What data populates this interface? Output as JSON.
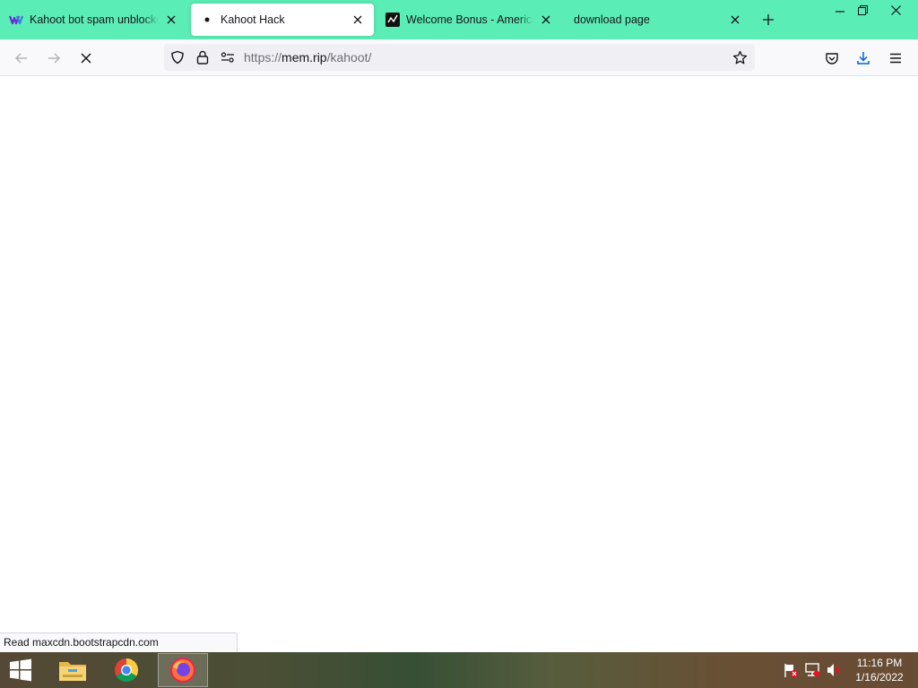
{
  "browser": {
    "tabs": [
      {
        "title": "Kahoot bot spam unblocked",
        "favicon": "kahoot-purple-icon",
        "active": false
      },
      {
        "title": "Kahoot Hack",
        "favicon": "dot-icon",
        "active": true
      },
      {
        "title": "Welcome Bonus - Americas",
        "favicon": "black-chart-icon",
        "active": false
      },
      {
        "title": "download page",
        "favicon": "none",
        "active": false
      }
    ],
    "address": {
      "scheme": "https://",
      "host": "mem.rip",
      "path": "/kahoot/"
    },
    "status_text": "Read maxcdn.bootstrapcdn.com",
    "theme_color": "#5bedb6"
  },
  "taskbar": {
    "apps": [
      "windows-start-icon",
      "file-explorer-icon",
      "chrome-icon",
      "firefox-icon"
    ],
    "active_app": "firefox",
    "clock": {
      "time": "11:16 PM",
      "date": "1/16/2022"
    }
  }
}
